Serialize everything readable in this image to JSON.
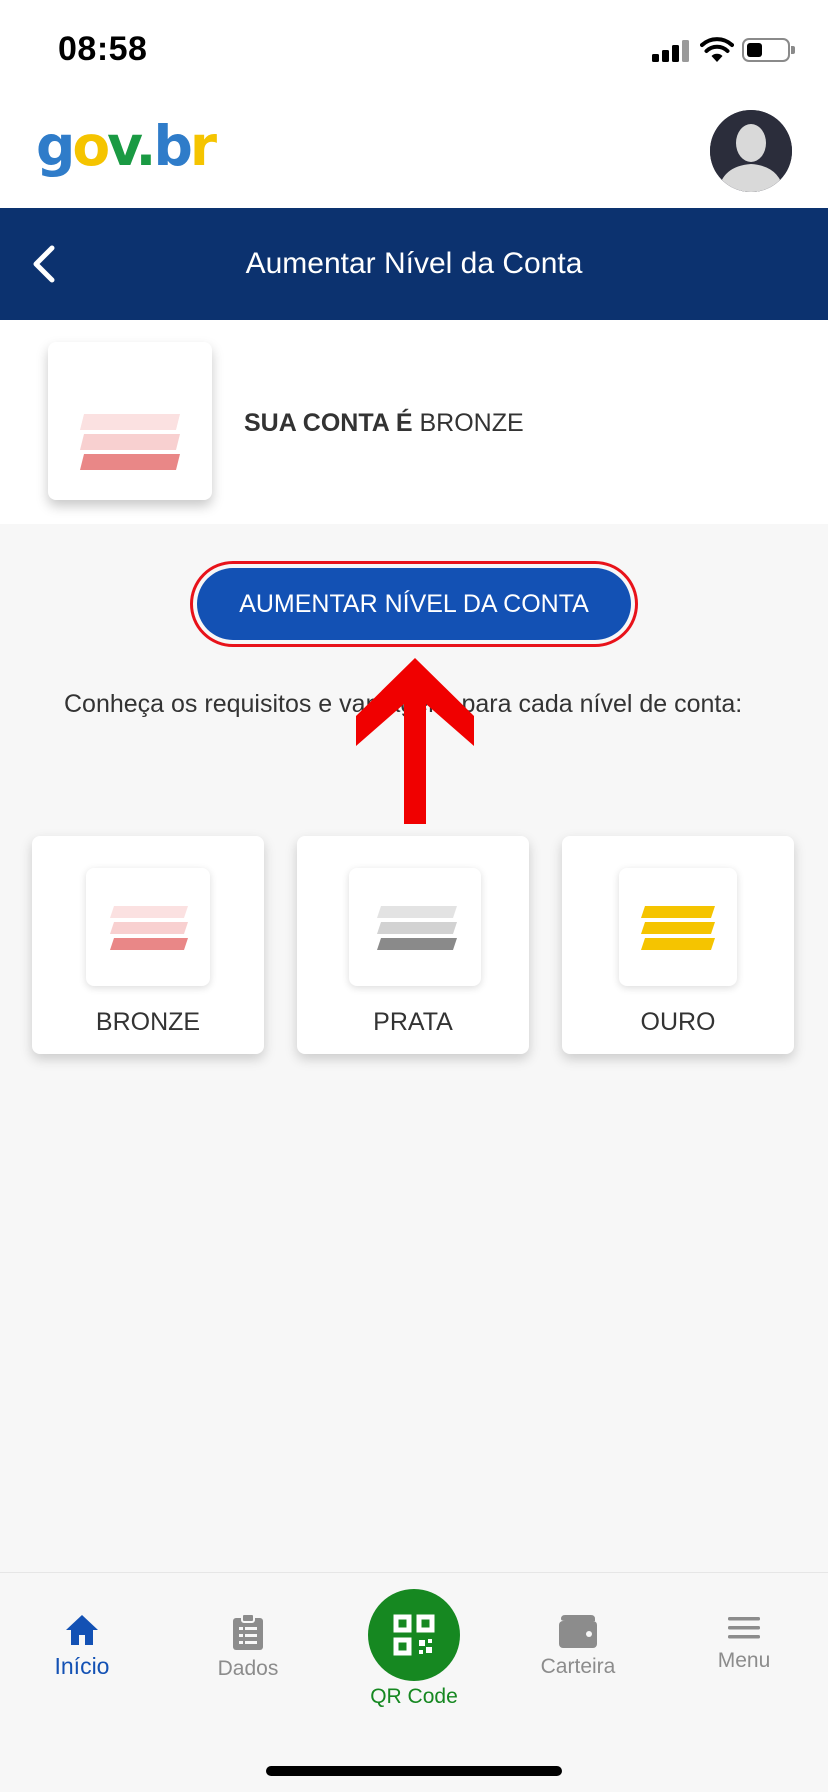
{
  "status_bar": {
    "time": "08:58"
  },
  "header": {
    "logo": {
      "g": "g",
      "o": "o",
      "v": "v",
      "dot": ".",
      "b": "b",
      "r": "r"
    }
  },
  "title_bar": {
    "title": "Aumentar Nível da Conta"
  },
  "account": {
    "prefix": "SUA CONTA É",
    "level": "BRONZE"
  },
  "cta": {
    "label": "AUMENTAR NÍVEL DA CONTA"
  },
  "info": {
    "text": "Conheça os requisitos e vantagens para cada nível de conta:"
  },
  "levels": [
    {
      "label": "BRONZE",
      "colors": [
        "#fbe1e1",
        "#f8d0d0",
        "#e98787"
      ]
    },
    {
      "label": "PRATA",
      "colors": [
        "#e3e3e3",
        "#d2d2d2",
        "#8a8a8a"
      ]
    },
    {
      "label": "OURO",
      "colors": [
        "#f5c400",
        "#f5c400",
        "#f5c400"
      ]
    }
  ],
  "bottom_nav": {
    "items": [
      {
        "label": "Início",
        "icon": "home-icon",
        "active": true
      },
      {
        "label": "Dados",
        "icon": "clipboard-icon"
      },
      {
        "label": "QR Code",
        "icon": "qr-code-icon"
      },
      {
        "label": "Carteira",
        "icon": "wallet-icon"
      },
      {
        "label": "Menu",
        "icon": "hamburger-icon"
      }
    ]
  },
  "colors": {
    "primary_blue": "#1351b4",
    "title_bar": "#0c326f",
    "qr_green": "#168821",
    "highlight_red": "#e8121a"
  }
}
